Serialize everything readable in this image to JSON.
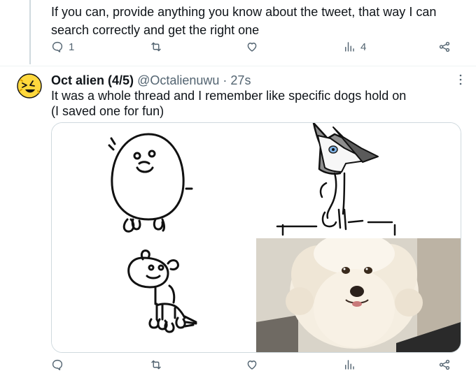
{
  "tweet1": {
    "text_line1": "If you can, provide anything you know about the tweet, that way I can",
    "text_line2": "search correctly and get the right one",
    "replies": "1",
    "views": "4",
    "icons": [
      "reply-icon",
      "retweet-icon",
      "like-icon",
      "views-icon",
      "share-icon"
    ]
  },
  "tweet2": {
    "name": "Oct alien (4/5)",
    "handle": "@Octalienuwu",
    "separator": "·",
    "time": "27s",
    "text_line1": "It was a whole thread and I remember like specific dogs hold on",
    "text_line2": "(I saved one for fun)",
    "media": [
      "egg-creature-doodle",
      "wolf-drawing",
      "dog-doodle",
      "bichon-dog-photo"
    ],
    "icons": [
      "reply-icon",
      "retweet-icon",
      "like-icon",
      "views-icon",
      "share-icon"
    ]
  },
  "colors": {
    "text": "#0f1419",
    "muted": "#536471",
    "border": "#cfd9de",
    "thread_line": "#cfd9de"
  }
}
